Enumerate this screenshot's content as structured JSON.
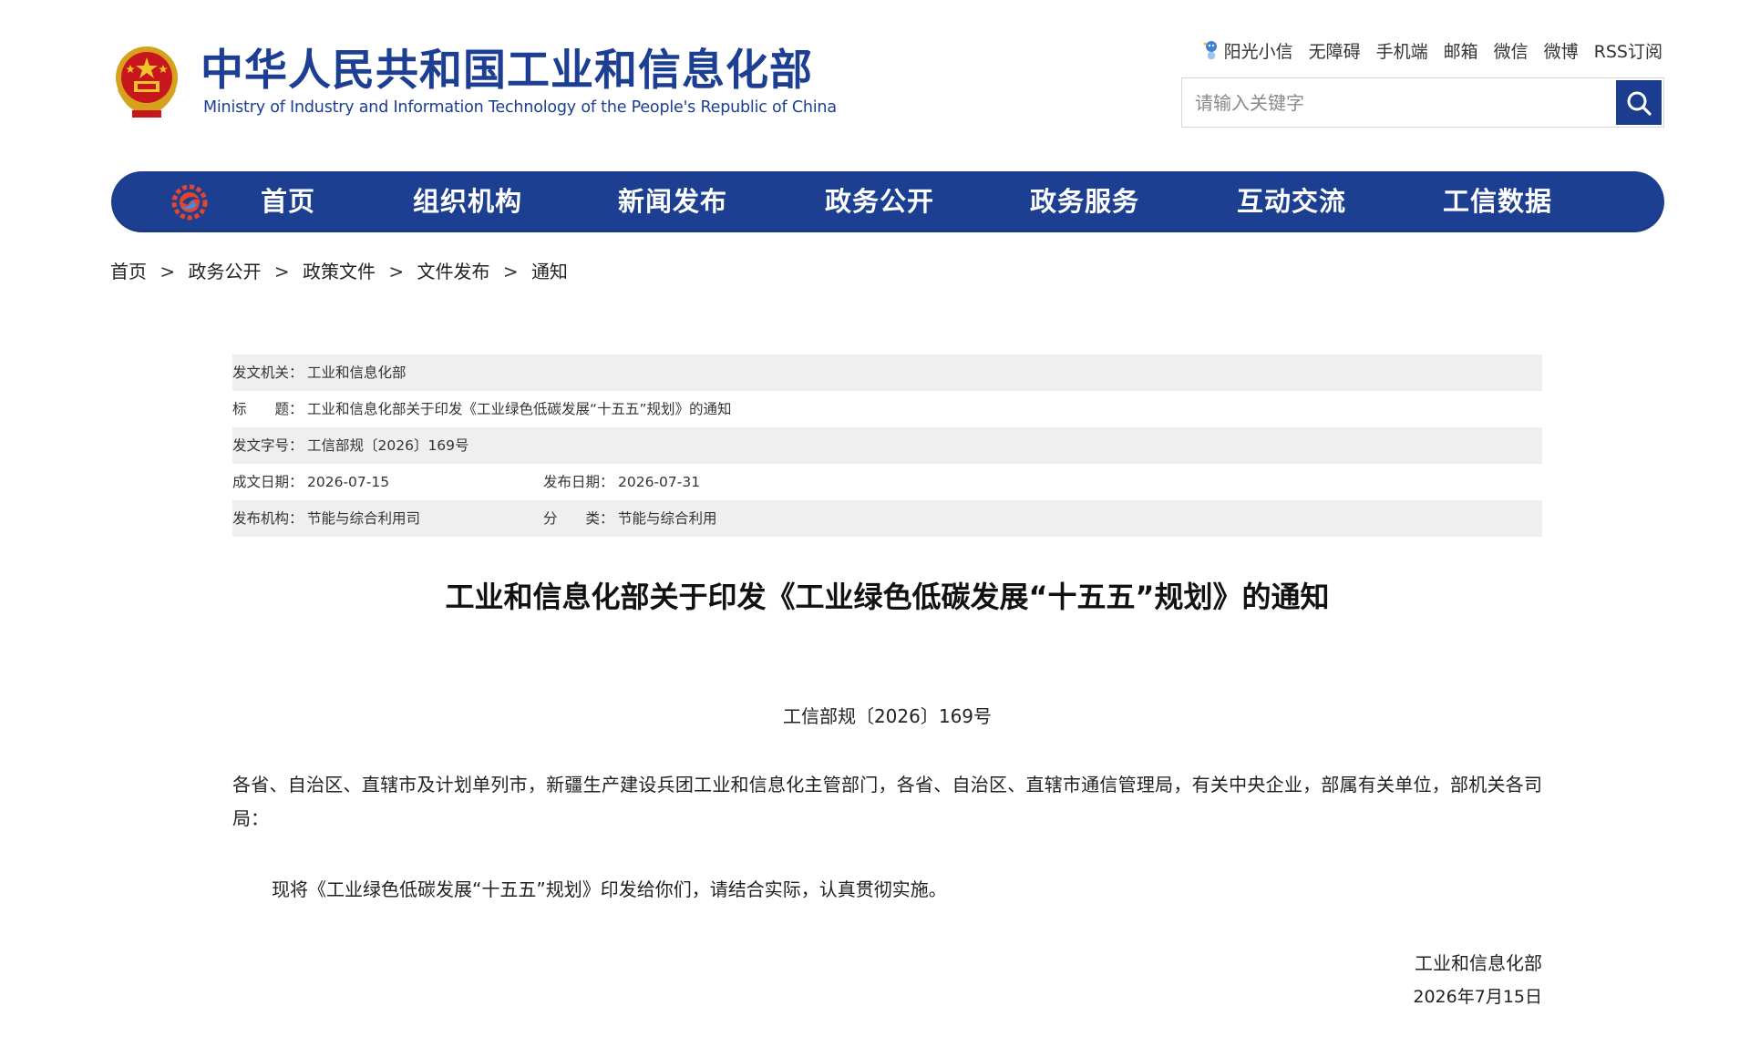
{
  "header": {
    "title": "中华人民共和国工业和信息化部",
    "subtitle": "Ministry of Industry and Information Technology of the People's Republic of China",
    "top_links": [
      "阳光小信",
      "无障碍",
      "手机端",
      "邮箱",
      "微信",
      "微博",
      "RSS订阅"
    ],
    "search": {
      "placeholder": "请输入关键字",
      "value": ""
    },
    "colors": {
      "brand_blue": "#1c3f93"
    }
  },
  "nav": {
    "items": [
      "首页",
      "组织机构",
      "新闻发布",
      "政务公开",
      "政务服务",
      "互动交流",
      "工信数据"
    ]
  },
  "breadcrumb": {
    "items": [
      "首页",
      "政务公开",
      "政策文件",
      "文件发布",
      "通知"
    ],
    "separator": ">"
  },
  "info": {
    "issuer_label": "发文机关：",
    "issuer": "工业和信息化部",
    "title_label": "标　　题：",
    "title": "工业和信息化部关于印发《工业绿色低碳发展“十五五”规划》的通知",
    "doc_no_label": "发文字号：",
    "doc_no": "工信部规〔2026〕169号",
    "written_date_label": "成文日期：",
    "written_date": "2026-07-15",
    "publish_date_label": "发布日期：",
    "publish_date": "2026-07-31",
    "publisher_label": "发布机构：",
    "publisher": "节能与综合利用司",
    "category_label": "分　　类：",
    "category": "节能与综合利用"
  },
  "document": {
    "title": "工业和信息化部关于印发《工业绿色低碳发展“十五五”规划》的通知",
    "number": "工信部规〔2026〕169号",
    "recipients": "各省、自治区、直辖市及计划单列市，新疆生产建设兵团工业和信息化主管部门，各省、自治区、直辖市通信管理局，有关中央企业，部属有关单位，部机关各司局：",
    "body": "现将《工业绿色低碳发展“十五五”规划》印发给你们，请结合实际，认真贯彻实施。",
    "signature_org": "工业和信息化部",
    "signature_date": "2026年7月15日"
  }
}
